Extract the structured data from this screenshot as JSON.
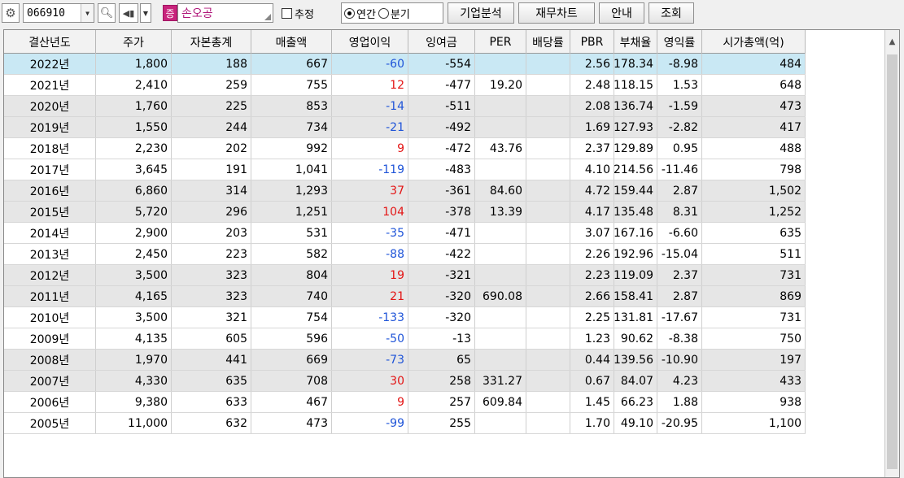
{
  "toolbar": {
    "code_value": "066910",
    "market_tag": "증",
    "stock_name": "손오공",
    "estimate_label": "추정",
    "annual_label": "연간",
    "quarterly_label": "분기",
    "company_analysis_label": "기업분석",
    "financial_chart_label": "재무차트",
    "guide_label": "안내",
    "search_label": "조회",
    "mode_selected": "annual"
  },
  "table": {
    "headers": [
      "결산년도",
      "주가",
      "자본총계",
      "매출액",
      "영업이익",
      "잉여금",
      "PER",
      "배당률",
      "PBR",
      "부채율",
      "영익률",
      "시가총액(억)"
    ],
    "rows": [
      [
        "2022년",
        "1,800",
        "188",
        "667",
        "-60",
        "-554",
        "",
        "",
        "2.56",
        "178.34",
        "-8.98",
        "484"
      ],
      [
        "2021년",
        "2,410",
        "259",
        "755",
        "12",
        "-477",
        "19.20",
        "",
        "2.48",
        "118.15",
        "1.53",
        "648"
      ],
      [
        "2020년",
        "1,760",
        "225",
        "853",
        "-14",
        "-511",
        "",
        "",
        "2.08",
        "136.74",
        "-1.59",
        "473"
      ],
      [
        "2019년",
        "1,550",
        "244",
        "734",
        "-21",
        "-492",
        "",
        "",
        "1.69",
        "127.93",
        "-2.82",
        "417"
      ],
      [
        "2018년",
        "2,230",
        "202",
        "992",
        "9",
        "-472",
        "43.76",
        "",
        "2.37",
        "129.89",
        "0.95",
        "488"
      ],
      [
        "2017년",
        "3,645",
        "191",
        "1,041",
        "-119",
        "-483",
        "",
        "",
        "4.10",
        "214.56",
        "-11.46",
        "798"
      ],
      [
        "2016년",
        "6,860",
        "314",
        "1,293",
        "37",
        "-361",
        "84.60",
        "",
        "4.72",
        "159.44",
        "2.87",
        "1,502"
      ],
      [
        "2015년",
        "5,720",
        "296",
        "1,251",
        "104",
        "-378",
        "13.39",
        "",
        "4.17",
        "135.48",
        "8.31",
        "1,252"
      ],
      [
        "2014년",
        "2,900",
        "203",
        "531",
        "-35",
        "-471",
        "",
        "",
        "3.07",
        "167.16",
        "-6.60",
        "635"
      ],
      [
        "2013년",
        "2,450",
        "223",
        "582",
        "-88",
        "-422",
        "",
        "",
        "2.26",
        "192.96",
        "-15.04",
        "511"
      ],
      [
        "2012년",
        "3,500",
        "323",
        "804",
        "19",
        "-321",
        "",
        "",
        "2.23",
        "119.09",
        "2.37",
        "731"
      ],
      [
        "2011년",
        "4,165",
        "323",
        "740",
        "21",
        "-320",
        "690.08",
        "",
        "2.66",
        "158.41",
        "2.87",
        "869"
      ],
      [
        "2010년",
        "3,500",
        "321",
        "754",
        "-133",
        "-320",
        "",
        "",
        "2.25",
        "131.81",
        "-17.67",
        "731"
      ],
      [
        "2009년",
        "4,135",
        "605",
        "596",
        "-50",
        "-13",
        "",
        "",
        "1.23",
        "90.62",
        "-8.38",
        "750"
      ],
      [
        "2008년",
        "1,970",
        "441",
        "669",
        "-73",
        "65",
        "",
        "",
        "0.44",
        "139.56",
        "-10.90",
        "197"
      ],
      [
        "2007년",
        "4,330",
        "635",
        "708",
        "30",
        "258",
        "331.27",
        "",
        "0.67",
        "84.07",
        "4.23",
        "433"
      ],
      [
        "2006년",
        "9,380",
        "633",
        "467",
        "9",
        "257",
        "609.84",
        "",
        "1.45",
        "66.23",
        "1.88",
        "938"
      ],
      [
        "2005년",
        "11,000",
        "632",
        "473",
        "-99",
        "255",
        "",
        "",
        "1.70",
        "49.10",
        "-20.95",
        "1,100"
      ]
    ],
    "row_styles": [
      "sel",
      "",
      "alt",
      "alt",
      "",
      "",
      "alt",
      "alt",
      "",
      "",
      "alt",
      "alt",
      "",
      "",
      "alt",
      "alt",
      "",
      ""
    ]
  },
  "colors": {
    "negative": "#1f54d8",
    "positive": "#e31414",
    "selected_row": "#c9e8f4"
  },
  "icons": {
    "settings": "gear-icon",
    "search": "magnifier-icon",
    "sound": "speaker-icon",
    "scroll_up": "chevron-up-icon"
  }
}
